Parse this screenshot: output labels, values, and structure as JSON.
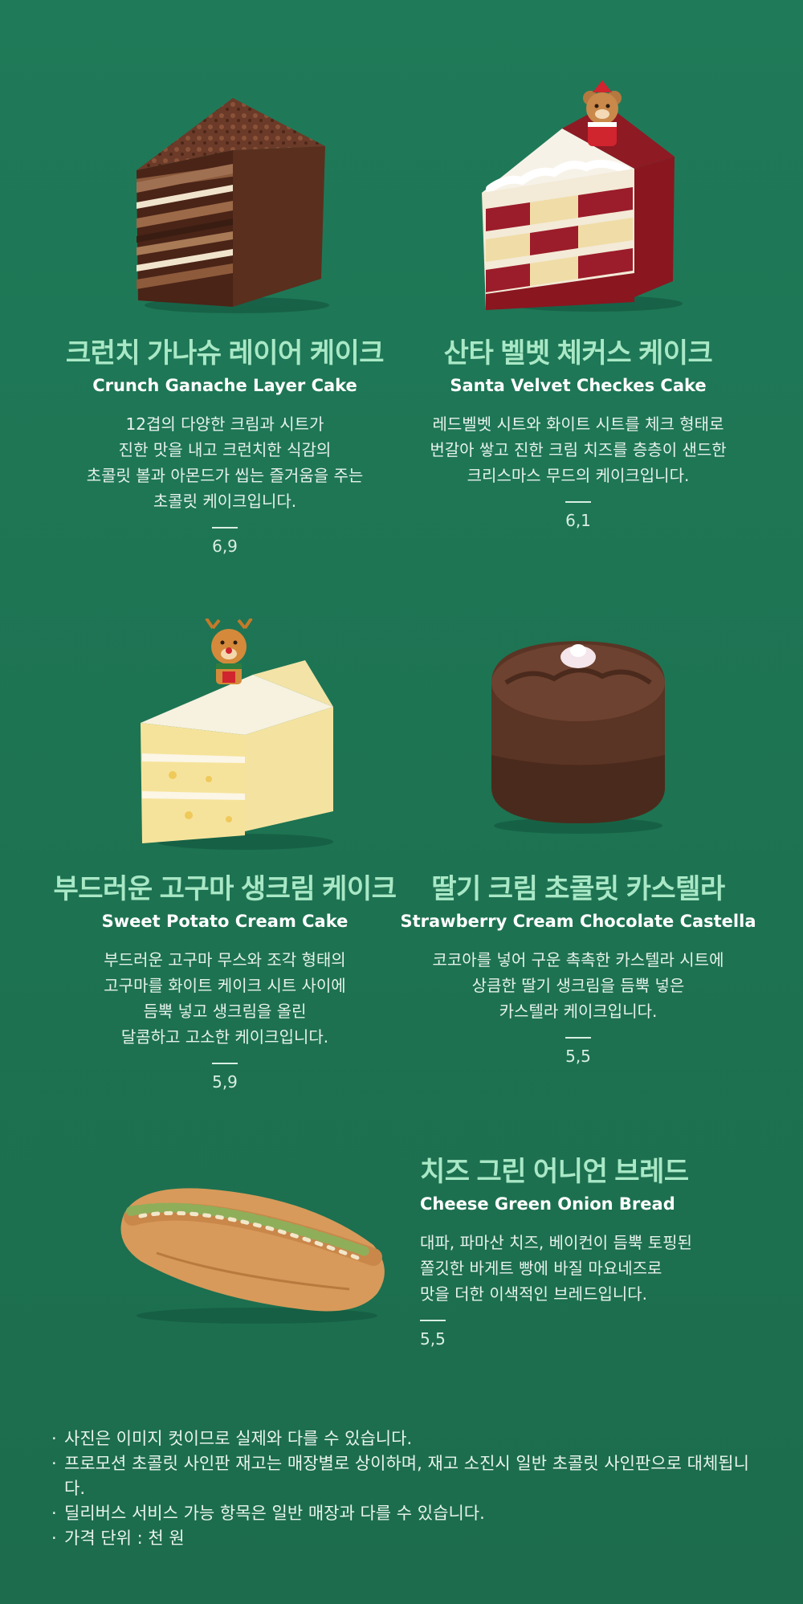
{
  "products": [
    {
      "name_ko": "크런치 가나슈 레이어 케이크",
      "name_en": "Crunch Ganache Layer Cake",
      "description": "12겹의 다양한 크림과 시트가\n진한 맛을 내고  크런치한 식감의\n초콜릿 볼과 아몬드가 씹는 즐거움을 주는\n초콜릿 케이크입니다.",
      "price": "6,9"
    },
    {
      "name_ko": "산타 벨벳 체커스 케이크",
      "name_en": "Santa Velvet Checkes Cake",
      "description": "레드벨벳 시트와 화이트 시트를 체크 형태로\n번갈아 쌓고 진한 크림 치즈를 층층이 샌드한\n크리스마스 무드의 케이크입니다.",
      "price": "6,1"
    },
    {
      "name_ko": "부드러운 고구마 생크림 케이크",
      "name_en": "Sweet Potato Cream Cake",
      "description": "부드러운 고구마 무스와 조각 형태의\n고구마를 화이트 케이크 시트 사이에\n듬뿍 넣고 생크림을 올린\n달콤하고 고소한 케이크입니다.",
      "price": "5,9"
    },
    {
      "name_ko": "딸기 크림 초콜릿 카스텔라",
      "name_en": "Strawberry Cream Chocolate Castella",
      "description": "코코아를 넣어 구운 촉촉한 카스텔라 시트에\n상큼한 딸기 생크림을 듬뿍 넣은\n카스텔라 케이크입니다.",
      "price": "5,5"
    },
    {
      "name_ko": "치즈 그린 어니언 브레드",
      "name_en": "Cheese Green Onion Bread",
      "description": "대파, 파마산 치즈, 베이컨이 듬뿍 토핑된\n쫄깃한 바게트 빵에 바질 마요네즈로\n맛을 더한 이색적인 브레드입니다.",
      "price": "5,5"
    }
  ],
  "notes": [
    "사진은 이미지 컷이므로 실제와 다를 수 있습니다.",
    "프로모션 초콜릿 사인판 재고는 매장별로 상이하며, 재고 소진시 일반 초콜릿 사인판으로 대체됩니다.",
    "딜리버스 서비스 가능 항목은 일반 매장과 다를 수 있습니다.",
    "가격 단위 : 천 원"
  ],
  "colors": {
    "background": "#1f7a59",
    "name_ko": "#a9e8c6",
    "text": "#ffffff"
  }
}
